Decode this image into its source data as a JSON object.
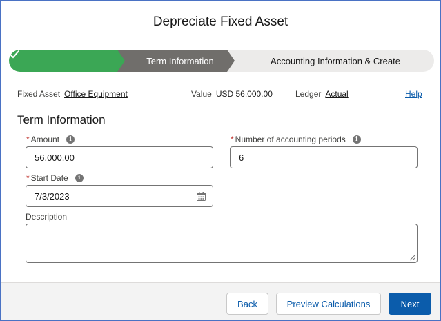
{
  "modal": {
    "title": "Depreciate Fixed Asset"
  },
  "path": {
    "stages": [
      {
        "label": "✓",
        "state": "complete",
        "color": "#3ba755"
      },
      {
        "label": "Term Information",
        "state": "current",
        "color": "#706e6b"
      },
      {
        "label": "Accounting Information & Create",
        "state": "incomplete",
        "color": "#ecebea"
      }
    ]
  },
  "summary": {
    "fixed_asset_label": "Fixed Asset",
    "fixed_asset_value": "Office Equipment",
    "value_label": "Value",
    "value_value": "USD 56,000.00",
    "ledger_label": "Ledger",
    "ledger_value": "Actual",
    "help_label": "Help"
  },
  "section": {
    "title": "Term Information"
  },
  "form": {
    "required_marker": "*",
    "info_glyph": "i",
    "amount": {
      "label": "Amount",
      "value": "56,000.00",
      "icon": "info-icon"
    },
    "periods": {
      "label": "Number of accounting periods",
      "value": "6",
      "icon": "info-icon"
    },
    "start_date": {
      "label": "Start Date",
      "value": "7/3/2023",
      "icon": "calendar-icon"
    },
    "description": {
      "label": "Description",
      "value": ""
    }
  },
  "footer": {
    "back_label": "Back",
    "preview_label": "Preview Calculations",
    "next_label": "Next"
  },
  "colors": {
    "brand": "#0b5cab",
    "success": "#3ba755",
    "current": "#706e6b",
    "required": "#c23934"
  }
}
